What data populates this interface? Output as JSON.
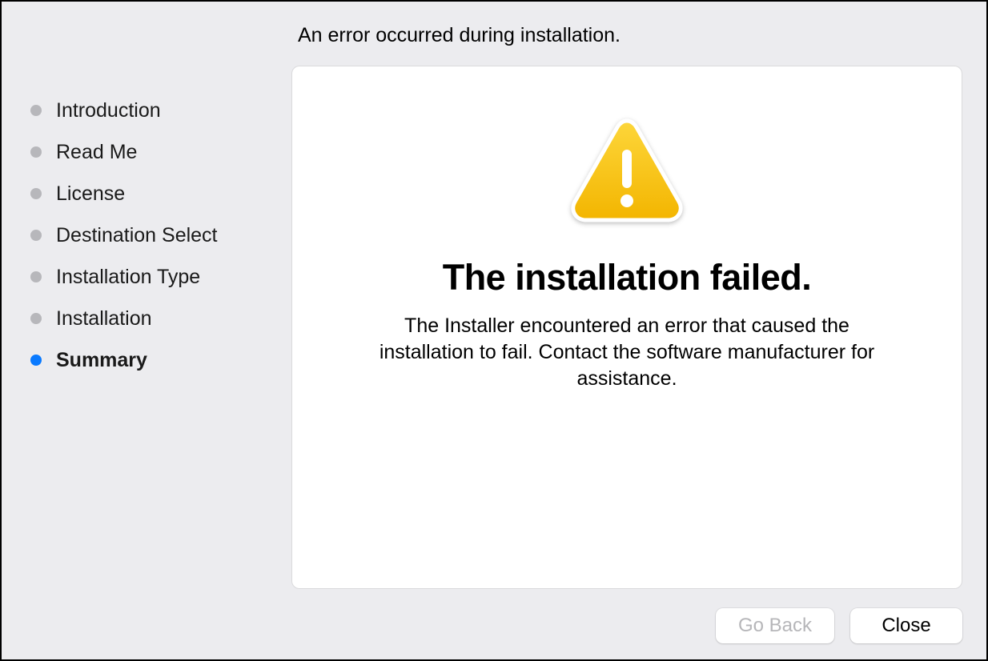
{
  "title": "An error occurred during installation.",
  "sidebar": {
    "items": [
      {
        "label": "Introduction",
        "active": false
      },
      {
        "label": "Read Me",
        "active": false
      },
      {
        "label": "License",
        "active": false
      },
      {
        "label": "Destination Select",
        "active": false
      },
      {
        "label": "Installation Type",
        "active": false
      },
      {
        "label": "Installation",
        "active": false
      },
      {
        "label": "Summary",
        "active": true
      }
    ]
  },
  "content": {
    "headline": "The installation failed.",
    "detail": "The Installer encountered an error that caused the installation to fail. Contact the software manufacturer for assistance."
  },
  "buttons": {
    "go_back": "Go Back",
    "close": "Close"
  }
}
